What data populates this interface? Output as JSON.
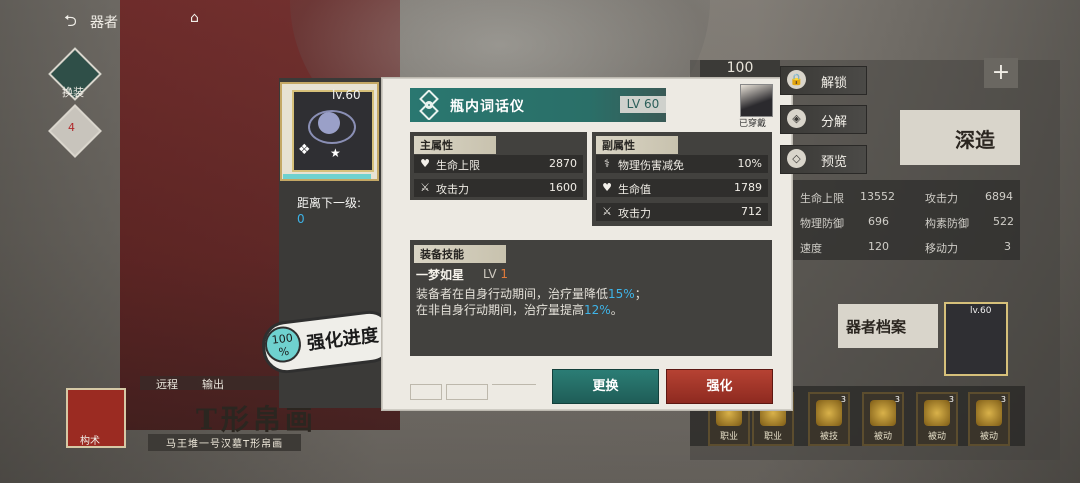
{
  "header": {
    "back_icon": "back-arrow-icon",
    "title": "器者",
    "home_icon": "home-icon"
  },
  "left_nav": {
    "swap_label": "换装",
    "favor_count": "4"
  },
  "bottom_left": {
    "tabs": [
      "远程",
      "输出"
    ],
    "class_label": "构术",
    "title": "T形帛画",
    "subtitle": "马王堆一号汉墓T形帛画"
  },
  "gear_card": {
    "level": "lv.60",
    "next_level_label": "距离下一级:",
    "next_level_value": "0",
    "progress_fraction": 1.0
  },
  "enhance_badge": {
    "percent": "100",
    "unit": "%",
    "label": "强化进度"
  },
  "item": {
    "name": "瓶内词话仪",
    "level": "LV 60",
    "equipped_label": "已穿戴"
  },
  "main_stats": {
    "header": "主属性",
    "rows": [
      {
        "icon": "heart-icon",
        "name": "生命上限",
        "value": "2870"
      },
      {
        "icon": "swords-icon",
        "name": "攻击力",
        "value": "1600"
      }
    ]
  },
  "sub_stats": {
    "header": "副属性",
    "rows": [
      {
        "icon": "blade-shield-icon",
        "name": "物理伤害减免",
        "value": "10%"
      },
      {
        "icon": "heart-icon",
        "name": "生命值",
        "value": "1789"
      },
      {
        "icon": "swords-icon",
        "name": "攻击力",
        "value": "712"
      }
    ]
  },
  "skill": {
    "header": "装备技能",
    "name": "一梦如星",
    "lv_prefix": "LV",
    "lv_value": "1",
    "line1_pre": "装备者在自身行动期间，治疗量降低",
    "line1_hl": "15%",
    "line1_post": "；",
    "line2_pre": "在非自身行动期间，治疗量提高",
    "line2_hl": "12%",
    "line2_post": "。"
  },
  "buttons": {
    "swap": "更换",
    "enhance": "强化"
  },
  "side_actions": [
    {
      "icon": "lock-icon",
      "label": "解锁"
    },
    {
      "icon": "decompose-icon",
      "label": "分解"
    },
    {
      "icon": "preview-icon",
      "label": "预览"
    }
  ],
  "right_panel": {
    "top_value": "100",
    "deep_label": "深造",
    "stats": [
      {
        "name": "生命上限",
        "value": "13552"
      },
      {
        "name": "攻击力",
        "value": "6894"
      },
      {
        "name": "物理防御",
        "value": "696"
      },
      {
        "name": "构素防御",
        "value": "522"
      },
      {
        "name": "速度",
        "value": "120"
      },
      {
        "name": "移动力",
        "value": "3"
      }
    ],
    "archive_label": "器者档案",
    "mini_gear_level": "lv.60",
    "tiles": [
      {
        "label": "职业",
        "num": "1"
      },
      {
        "label": "职业",
        "num": "1"
      },
      {
        "label": "被技",
        "num": "3"
      },
      {
        "label": "被动",
        "num": "3"
      },
      {
        "label": "被动",
        "num": "3"
      },
      {
        "label": "被动",
        "num": "3"
      }
    ]
  },
  "colors": {
    "accent_teal": "#2a7770",
    "accent_red": "#b64233",
    "highlight_blue": "#3fb4e8",
    "progress_cyan": "#6fd1cf"
  }
}
